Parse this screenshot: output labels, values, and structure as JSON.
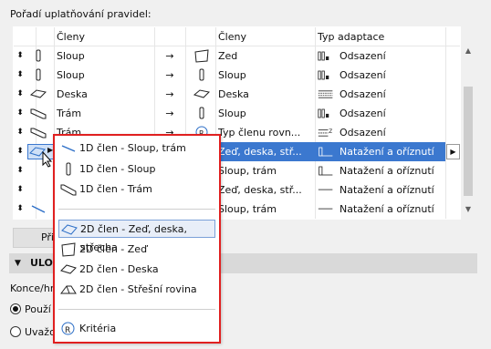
{
  "section_title": "Pořadí uplatňování pravidel:",
  "table": {
    "headers": {
      "col1": "Členy",
      "col2": "Členy",
      "col3": "Typ adaptace"
    },
    "rows": [
      {
        "left": "Sloup",
        "right": "Zeď",
        "adapt": "Odsazení",
        "left_icon": "column-icon",
        "right_icon": "wall-icon",
        "adapt_icon": "offset-icon"
      },
      {
        "left": "Sloup",
        "right": "Sloup",
        "adapt": "Odsazení",
        "left_icon": "column-icon",
        "right_icon": "column-icon",
        "adapt_icon": "offset-icon"
      },
      {
        "left": "Deska",
        "right": "Deska",
        "adapt": "Odsazení",
        "left_icon": "slab-icon",
        "right_icon": "slab-icon",
        "adapt_icon": "slab-offset-icon"
      },
      {
        "left": "Trám",
        "right": "Sloup",
        "adapt": "Odsazení",
        "left_icon": "beam-icon",
        "right_icon": "column-icon",
        "adapt_icon": "offset-icon"
      },
      {
        "left": "Trám",
        "right": "Typ členu rovn...",
        "adapt": "Odsazení",
        "left_icon": "beam-icon",
        "right_icon": "criteria-icon",
        "adapt_icon": "z-offset-icon"
      },
      {
        "left": "",
        "right": "Zeď, deska, stř...",
        "adapt": "Natažení a oříznutí",
        "left_icon": "slab-icon",
        "right_icon": "",
        "adapt_icon": "extend-trim-icon"
      },
      {
        "left": "",
        "right": "Sloup, trám",
        "adapt": "Natažení a oříznutí",
        "left_icon": "",
        "right_icon": "",
        "adapt_icon": "extend-trim-icon"
      },
      {
        "left": "",
        "right": "Zeď, deska, stř...",
        "adapt": "Natažení a oříznutí",
        "left_icon": "",
        "right_icon": "",
        "adapt_icon": "line-icon"
      },
      {
        "left": "",
        "right": "Sloup, trám",
        "adapt": "Natažení a oříznutí",
        "left_icon": "line-1d-icon",
        "right_icon": "",
        "adapt_icon": "line-icon"
      }
    ]
  },
  "button_partial": "Při",
  "group_header": "ULOŽ",
  "konce_label": "Konce/hr",
  "radios": [
    {
      "label": "Použí",
      "checked": true
    },
    {
      "label": "Uvažo",
      "checked": false
    }
  ],
  "popup": {
    "items_1d": [
      {
        "label": "1D člen - Sloup, trám",
        "icon": "line-1d-icon"
      },
      {
        "label": "1D člen - Sloup",
        "icon": "column-icon"
      },
      {
        "label": "1D člen - Trám",
        "icon": "beam-icon"
      }
    ],
    "items_2d": [
      {
        "label": "2D člen - Zeď, deska, střecha",
        "icon": "plane-2d-icon"
      },
      {
        "label": "2D člen - Zeď",
        "icon": "wall-icon"
      },
      {
        "label": "2D člen - Deska",
        "icon": "slab-icon"
      },
      {
        "label": "2D člen - Střešní rovina",
        "icon": "roof-icon"
      }
    ],
    "criteria": {
      "label": "Kritéria",
      "icon": "criteria-icon"
    }
  },
  "colors": {
    "selection": "#3b78cf",
    "popup_border": "#e02020",
    "icon_blue": "#2d6fc7"
  }
}
